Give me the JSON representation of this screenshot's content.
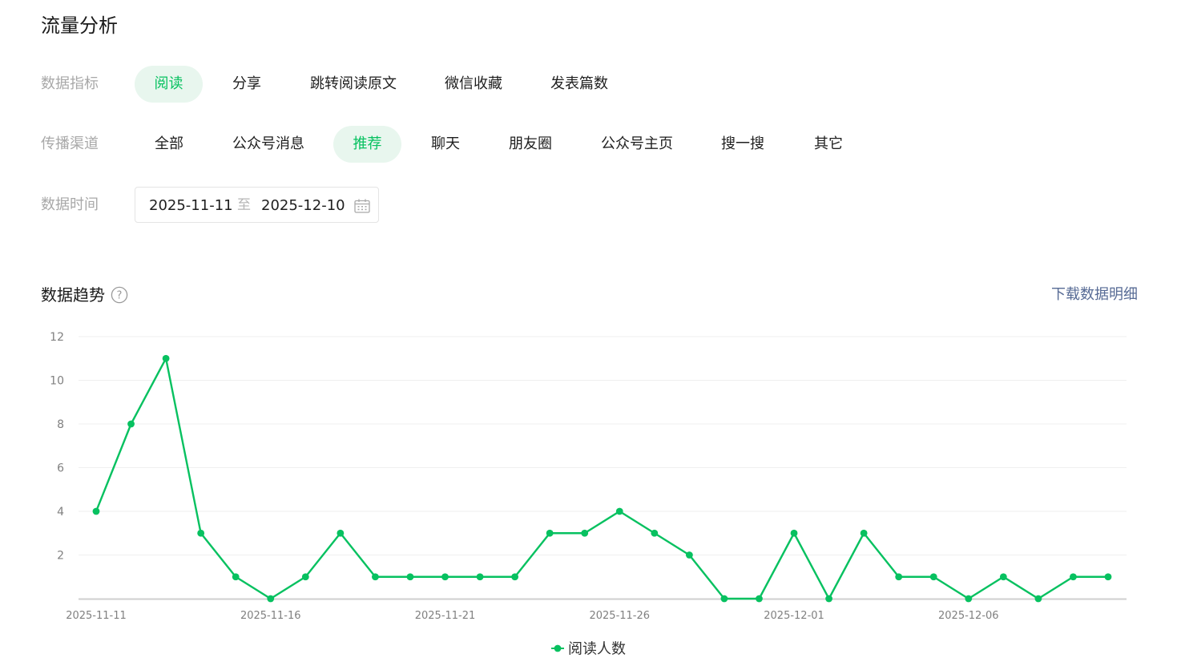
{
  "page": {
    "title": "流量分析"
  },
  "filters": {
    "metric": {
      "label": "数据指标",
      "options": [
        "阅读",
        "分享",
        "跳转阅读原文",
        "微信收藏",
        "发表篇数"
      ],
      "selected": "阅读"
    },
    "channel": {
      "label": "传播渠道",
      "options": [
        "全部",
        "公众号消息",
        "推荐",
        "聊天",
        "朋友圈",
        "公众号主页",
        "搜一搜",
        "其它"
      ],
      "selected": "推荐"
    },
    "time": {
      "label": "数据时间",
      "start": "2025-11-11",
      "separator": "至",
      "end": "2025-12-10",
      "icon": "calendar-icon"
    }
  },
  "trend": {
    "title": "数据趋势",
    "help_icon": "question-circle-icon",
    "download_label": "下载数据明细"
  },
  "colors": {
    "accent": "#07c160",
    "active_pill_bg": "#e8f6ee",
    "link": "#576b95",
    "muted_label": "#a8a8a8"
  },
  "chart_data": {
    "type": "line",
    "title": "",
    "xlabel": "",
    "ylabel": "",
    "x": [
      "2025-11-11",
      "2025-11-12",
      "2025-11-13",
      "2025-11-14",
      "2025-11-15",
      "2025-11-16",
      "2025-11-17",
      "2025-11-18",
      "2025-11-19",
      "2025-11-20",
      "2025-11-21",
      "2025-11-22",
      "2025-11-23",
      "2025-11-24",
      "2025-11-25",
      "2025-11-26",
      "2025-11-27",
      "2025-11-28",
      "2025-11-29",
      "2025-11-30",
      "2025-12-01",
      "2025-12-02",
      "2025-12-03",
      "2025-12-04",
      "2025-12-05",
      "2025-12-06",
      "2025-12-07",
      "2025-12-08",
      "2025-12-09",
      "2025-12-10"
    ],
    "x_tick_labels": [
      "2025-11-11",
      "2025-11-16",
      "2025-11-21",
      "2025-11-26",
      "2025-12-01",
      "2025-12-06"
    ],
    "y_ticks": [
      2,
      4,
      6,
      8,
      10,
      12
    ],
    "ylim": [
      0,
      12
    ],
    "grid": true,
    "legend_position": "bottom-center",
    "series": [
      {
        "name": "阅读人数",
        "color": "#07c160",
        "values": [
          4,
          8,
          11,
          3,
          1,
          0,
          1,
          3,
          1,
          1,
          1,
          1,
          1,
          3,
          3,
          4,
          3,
          2,
          0,
          0,
          3,
          0,
          3,
          1,
          1,
          0,
          1,
          0,
          1,
          1
        ]
      }
    ]
  }
}
